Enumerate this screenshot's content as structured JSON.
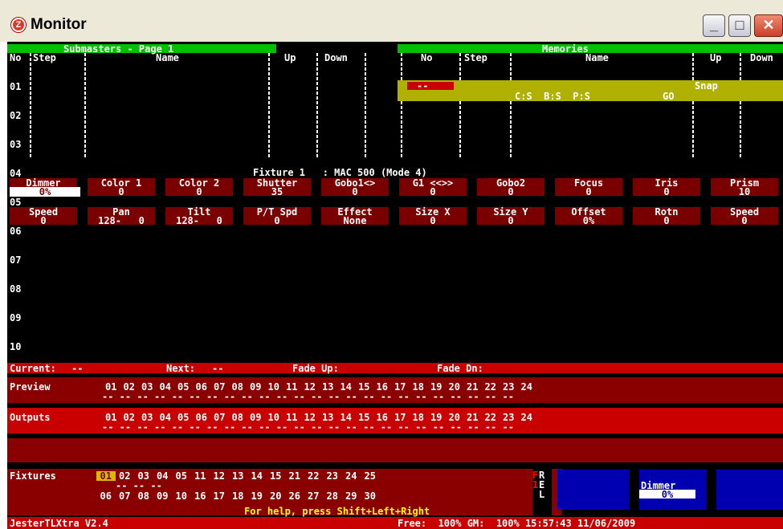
{
  "window": {
    "title": "Monitor",
    "icon": "jester-z-icon",
    "buttons": {
      "minimize": "_",
      "maximize": "□",
      "close": "✕"
    }
  },
  "submasters": {
    "title": "Submasters - Page 1",
    "headers": {
      "no": "No",
      "step": "Step",
      "name": "Name",
      "up": "Up",
      "down": "Down"
    },
    "rows": [
      "01",
      "02",
      "03",
      "04",
      "05",
      "06",
      "07",
      "08",
      "09",
      "10"
    ]
  },
  "memories": {
    "title": "Memories",
    "headers": {
      "no": "No",
      "step": "Step",
      "name": "Name",
      "up": "Up",
      "down": "Down"
    },
    "current_row": {
      "no": "--",
      "name": "C:S  B:S  P:S",
      "go": "GO",
      "up": "Snap"
    }
  },
  "fixture": {
    "title": "Fixture 1   : MAC 500 (Mode 4)",
    "row1": [
      {
        "label": "Dimmer",
        "value": "0%"
      },
      {
        "label": "Color 1",
        "value": "0"
      },
      {
        "label": "Color 2",
        "value": "0"
      },
      {
        "label": "Shutter",
        "value": "35"
      },
      {
        "label": "Gobo1<>",
        "value": "0"
      },
      {
        "label": "G1 <<>>",
        "value": "0"
      },
      {
        "label": "Gobo2",
        "value": "0"
      },
      {
        "label": "Focus",
        "value": "0"
      },
      {
        "label": "Iris",
        "value": "0"
      },
      {
        "label": "Prism",
        "value": "10"
      }
    ],
    "row2": [
      {
        "label": "Speed",
        "value": "0"
      },
      {
        "label": "Pan",
        "value": "128-   0"
      },
      {
        "label": "Tilt",
        "value": "128-   0"
      },
      {
        "label": "P/T Spd",
        "value": "0"
      },
      {
        "label": "Effect",
        "value": "None"
      },
      {
        "label": "Size X",
        "value": "0"
      },
      {
        "label": "Size Y",
        "value": "0"
      },
      {
        "label": "Offset",
        "value": "0%"
      },
      {
        "label": "Rotn",
        "value": "0"
      },
      {
        "label": "Speed",
        "value": "0"
      }
    ]
  },
  "status": {
    "current_label": "Current:",
    "current_value": "--",
    "next_label": "Next:",
    "next_value": "--",
    "fade_up_label": "Fade Up:",
    "fade_dn_label": "Fade Dn:"
  },
  "channels": [
    "01",
    "02",
    "03",
    "04",
    "05",
    "06",
    "07",
    "08",
    "09",
    "10",
    "11",
    "12",
    "13",
    "14",
    "15",
    "16",
    "17",
    "18",
    "19",
    "20",
    "21",
    "22",
    "23",
    "24"
  ],
  "preview_label": "Preview",
  "outputs_label": "Outputs",
  "fixtures": {
    "label": "Fixtures",
    "row1": [
      "01",
      "02",
      "03",
      "04",
      "05",
      "11",
      "12",
      "13",
      "14",
      "15",
      "21",
      "22",
      "23",
      "24",
      "25"
    ],
    "row2": [
      "06",
      "07",
      "08",
      "09",
      "10",
      "16",
      "17",
      "18",
      "19",
      "20",
      "26",
      "27",
      "28",
      "29",
      "30"
    ],
    "rel_letters": {
      "r": "R",
      "e": "E",
      "l": "L",
      "f": "F",
      "one": "1"
    },
    "dimmer_label": "Dimmer",
    "dimmer_value": "0%"
  },
  "footer": {
    "app_version": "JesterTLXtra V2.4",
    "help_text": "For help, press Shift+Left+Right",
    "status_line": "Free:  100% GM:  100% 15:57:43 11/06/2009"
  },
  "colors": {
    "accent_green": "#00c000",
    "memory_yellow": "#b0b000",
    "param_red": "#7a0000",
    "bar_red": "#c80000",
    "fixture_blue": "#0000b0"
  }
}
